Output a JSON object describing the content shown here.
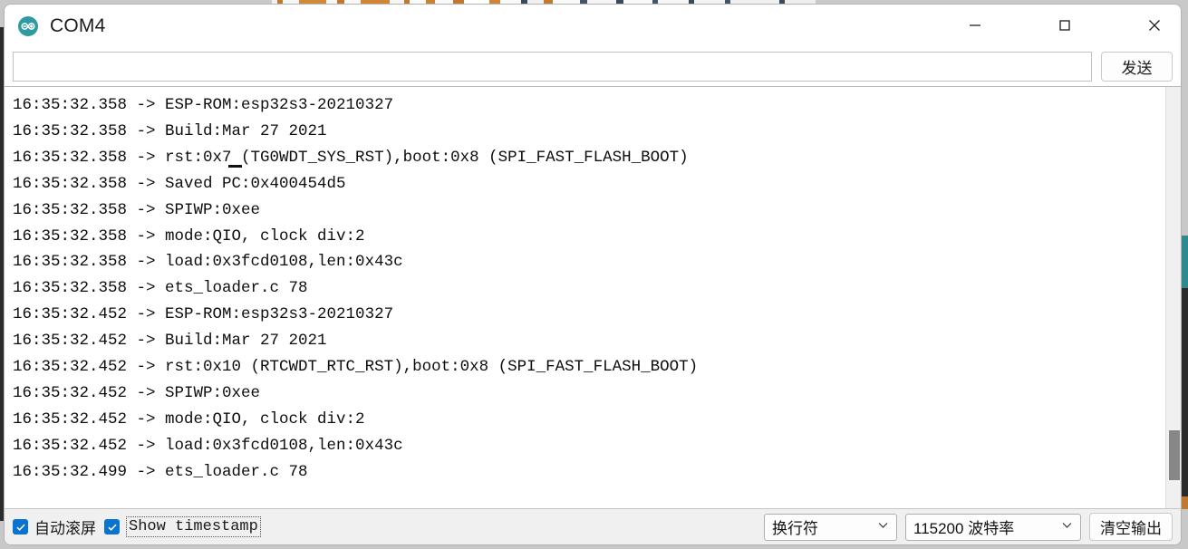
{
  "window": {
    "title": "COM4",
    "app_icon": "arduino-infinity-icon",
    "controls": {
      "minimize": "minimize-icon",
      "maximize": "maximize-icon",
      "close": "close-icon"
    }
  },
  "send_row": {
    "input_value": "",
    "input_placeholder": "",
    "send_label": "发送"
  },
  "terminal": {
    "lines": [
      "16:35:32.358 -> ESP-ROM:esp32s3-20210327",
      "16:35:32.358 -> Build:Mar 27 2021",
      "16:35:32.358 -> rst:0x7 (TG0WDT_SYS_RST),boot:0x8 (SPI_FAST_FLASH_BOOT)",
      "16:35:32.358 -> Saved PC:0x400454d5",
      "16:35:32.358 -> SPIWP:0xee",
      "16:35:32.358 -> mode:QIO, clock div:2",
      "16:35:32.358 -> load:0x3fcd0108,len:0x43c",
      "16:35:32.358 -> ets_loader.c 78",
      "16:35:32.452 -> ESP-ROM:esp32s3-20210327",
      "16:35:32.452 -> Build:Mar 27 2021",
      "16:35:32.452 -> rst:0x10 (RTCWDT_RTC_RST),boot:0x8 (SPI_FAST_FLASH_BOOT)",
      "16:35:32.452 -> SPIWP:0xee",
      "16:35:32.452 -> mode:QIO, clock div:2",
      "16:35:32.452 -> load:0x3fcd0108,len:0x43c",
      "16:35:32.499 -> ets_loader.c 78"
    ]
  },
  "status_bar": {
    "autoscroll_label": "自动滚屏",
    "autoscroll_checked": true,
    "timestamp_label": "Show timestamp",
    "timestamp_checked": true,
    "newline_selected": "换行符",
    "baud_selected": "115200 波特率",
    "clear_label": "清空输出"
  },
  "colors": {
    "accent": "#0a72cf",
    "arduino_teal": "#2f8a8f",
    "window_bg": "#ffffff",
    "statusbar_bg": "#f0f0f0",
    "scrollbar_thumb": "#878787"
  }
}
